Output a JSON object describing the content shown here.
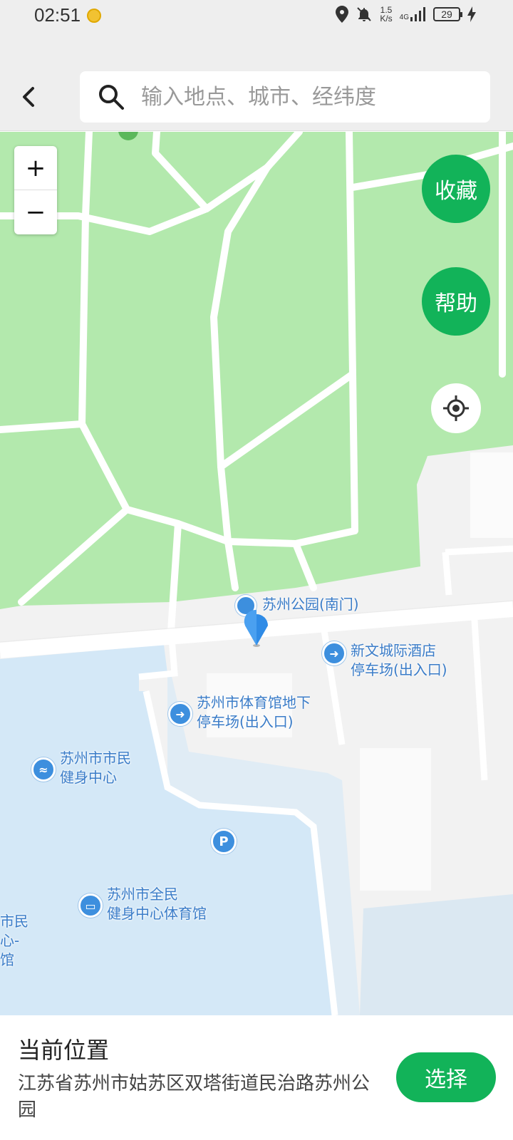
{
  "status_bar": {
    "time": "02:51",
    "net_speed_value": "1.5",
    "net_speed_unit": "K/s",
    "network_type": "4G",
    "battery": "29"
  },
  "header": {
    "search_placeholder": "输入地点、城市、经纬度"
  },
  "map_controls": {
    "zoom_in": "+",
    "zoom_out": "−",
    "favorite": "收藏",
    "help": "帮助"
  },
  "map": {
    "pois": [
      {
        "label": "苏州公园(南门)",
        "icon": "pin-marker-icon"
      },
      {
        "label": "新文城际酒店\n停车场(出入口)",
        "icon": "entrance-icon"
      },
      {
        "label": "苏州市体育馆地下\n停车场(出入口)",
        "icon": "entrance-icon"
      },
      {
        "label": "苏州市市民\n健身中心",
        "icon": "fitness-icon"
      },
      {
        "label": "P",
        "icon": "parking-icon"
      },
      {
        "label": "苏州市全民\n健身中心体育馆",
        "icon": "gym-icon"
      },
      {
        "label": "市民\n心-\n馆",
        "icon": ""
      }
    ],
    "colors": {
      "park": "#b3e9ad",
      "water": "#d4e8f7",
      "road": "#ffffff",
      "ground": "#f2f2f2",
      "poi": "#3d8fde"
    }
  },
  "bottom_panel": {
    "title": "当前位置",
    "address": "江苏省苏州市姑苏区双塔街道民治路苏州公园",
    "select_button": "选择"
  },
  "colors": {
    "accent": "#12b359"
  }
}
